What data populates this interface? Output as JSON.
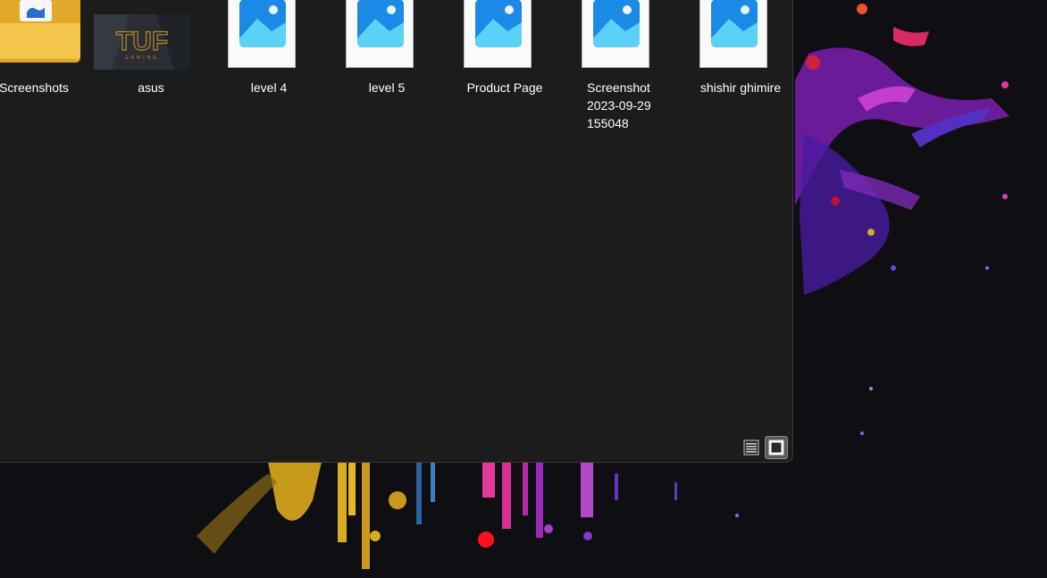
{
  "desktop": {
    "wallpaper_icon": "paint-splash-wallpaper"
  },
  "explorer": {
    "items": [
      {
        "label": "Screenshots",
        "icon": "folder-icon"
      },
      {
        "label": "asus",
        "icon": "image-thumbnail"
      },
      {
        "label": "level 4",
        "icon": "photo-file-icon"
      },
      {
        "label": "level 5",
        "icon": "photo-file-icon"
      },
      {
        "label": "Product Page",
        "icon": "photo-file-icon"
      },
      {
        "label": "Screenshot 2023-09-29 155048",
        "icon": "photo-file-icon"
      },
      {
        "label": "shishir ghimire",
        "icon": "photo-file-icon"
      }
    ],
    "view_buttons": [
      {
        "name": "details-view",
        "icon": "details-view-icon",
        "active": false
      },
      {
        "name": "large-icons-view",
        "icon": "large-icons-view-icon",
        "active": true
      }
    ],
    "thumbnail_text": "TUF",
    "thumbnail_subtext": "GAMING"
  },
  "colors": {
    "window_bg": "#1c1c1c",
    "label_text": "#ffffff",
    "photo_icon_blue": "#1a8ae6",
    "folder_yellow": "#f3c54b"
  }
}
